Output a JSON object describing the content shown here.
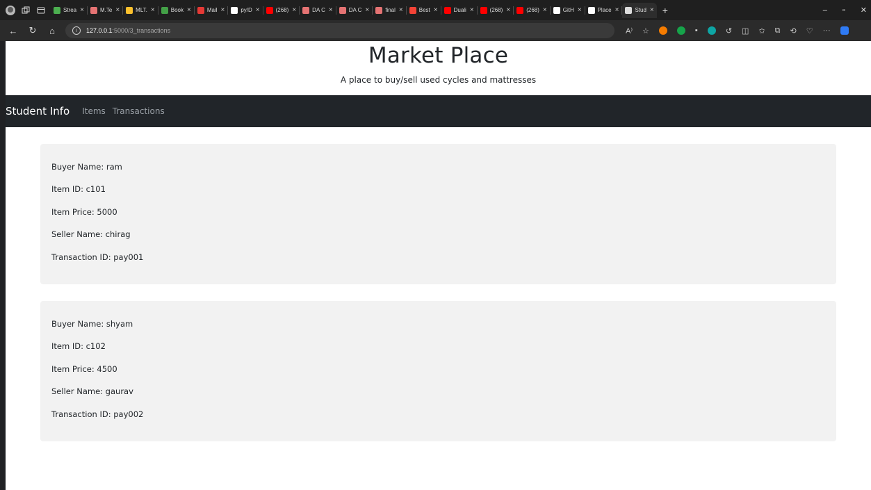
{
  "browser": {
    "tabs": [
      {
        "title": "Strea",
        "color": "#4caf50"
      },
      {
        "title": "M.Te",
        "color": "#e57373"
      },
      {
        "title": "MLT.",
        "color": "#fbc02d"
      },
      {
        "title": "Book",
        "color": "#43a047"
      },
      {
        "title": "Mail",
        "color": "#e53935"
      },
      {
        "title": "py/D",
        "color": "#ffffff"
      },
      {
        "title": "(268)",
        "color": "#ff0000"
      },
      {
        "title": "DA C",
        "color": "#e57373"
      },
      {
        "title": "DA C",
        "color": "#e57373"
      },
      {
        "title": "final",
        "color": "#e57373"
      },
      {
        "title": "Best",
        "color": "#f44336"
      },
      {
        "title": "Duali",
        "color": "#ff0000"
      },
      {
        "title": "(268)",
        "color": "#ff0000"
      },
      {
        "title": "(268)",
        "color": "#ff0000"
      },
      {
        "title": "GitH",
        "color": "#ffffff"
      },
      {
        "title": "Place",
        "color": "#ffffff"
      },
      {
        "title": "Stud",
        "color": "#dcdcdc"
      }
    ],
    "url_host": "127.0.0.1",
    "url_path": ":5000/3_transactions"
  },
  "header": {
    "title": "Market Place",
    "subtitle": "A place to buy/sell used cycles and mattresses"
  },
  "navbar": {
    "brand": "Student Info",
    "links": [
      "Items",
      "Transactions"
    ]
  },
  "transactions": [
    {
      "buyer": "Buyer Name: ram",
      "item_id": "Item ID: c101",
      "price": "Item Price: 5000",
      "seller": "Seller Name: chirag",
      "txn_id": "Transaction ID: pay001"
    },
    {
      "buyer": "Buyer Name: shyam",
      "item_id": "Item ID: c102",
      "price": "Item Price: 4500",
      "seller": "Seller Name: gaurav",
      "txn_id": "Transaction ID: pay002"
    }
  ]
}
